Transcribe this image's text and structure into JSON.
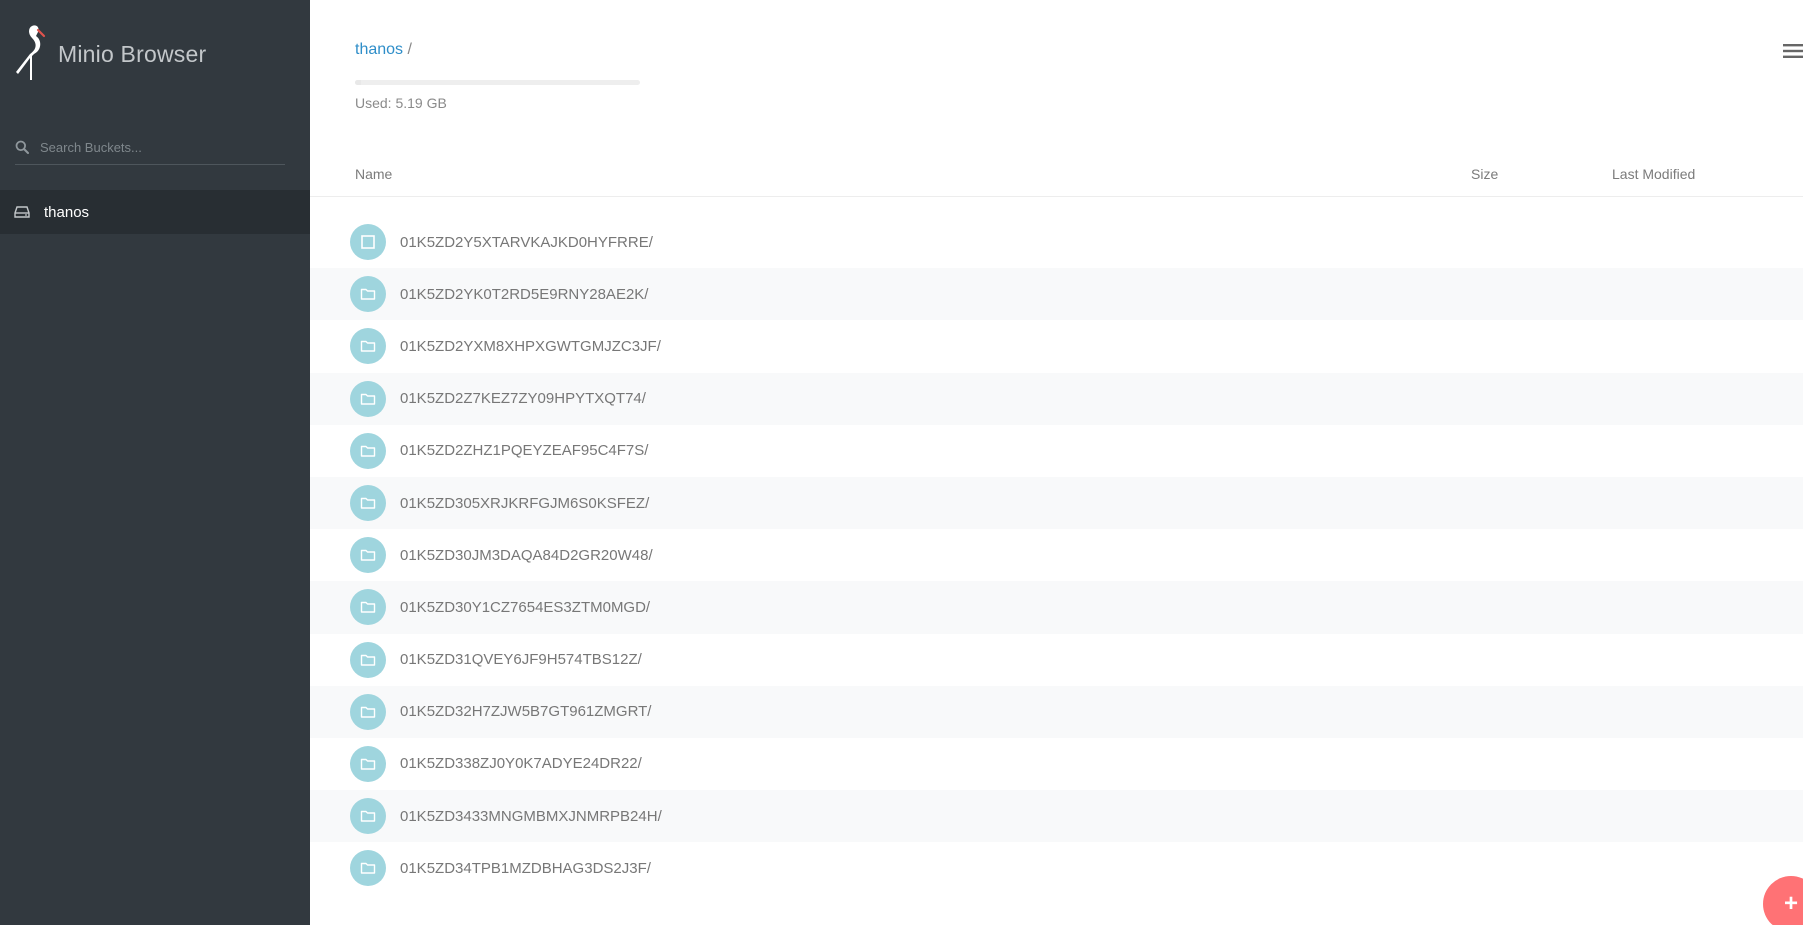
{
  "app": {
    "title": "Minio Browser"
  },
  "search": {
    "placeholder": "Search Buckets..."
  },
  "sidebar": {
    "buckets": [
      {
        "label": "thanos",
        "icon": "drive-icon"
      }
    ]
  },
  "header": {
    "breadcrumb_bucket": "thanos",
    "breadcrumb_sep": "/",
    "usage_label": "Used: 5.19 GB",
    "menu_icon": "hamburger-icon"
  },
  "table": {
    "columns": {
      "name": "Name",
      "size": "Size",
      "modified": "Last Modified"
    },
    "rows": [
      {
        "name": "01K5ZD2Y5XTARVKAJKD0HYFRRE/",
        "icon": "checkbox-icon"
      },
      {
        "name": "01K5ZD2YK0T2RD5E9RNY28AE2K/",
        "icon": "folder-icon"
      },
      {
        "name": "01K5ZD2YXM8XHPXGWTGMJZC3JF/",
        "icon": "folder-icon"
      },
      {
        "name": "01K5ZD2Z7KEZ7ZY09HPYTXQT74/",
        "icon": "folder-icon"
      },
      {
        "name": "01K5ZD2ZHZ1PQEYZEAF95C4F7S/",
        "icon": "folder-icon"
      },
      {
        "name": "01K5ZD305XRJKRFGJM6S0KSFEZ/",
        "icon": "folder-icon"
      },
      {
        "name": "01K5ZD30JM3DAQA84D2GR20W48/",
        "icon": "folder-icon"
      },
      {
        "name": "01K5ZD30Y1CZ7654ES3ZTM0MGD/",
        "icon": "folder-icon"
      },
      {
        "name": "01K5ZD31QVEY6JF9H574TBS12Z/",
        "icon": "folder-icon"
      },
      {
        "name": "01K5ZD32H7ZJW5B7GT961ZMGRT/",
        "icon": "folder-icon"
      },
      {
        "name": "01K5ZD338ZJ0Y0K7ADYE24DR22/",
        "icon": "folder-icon"
      },
      {
        "name": "01K5ZD3433MNGMBMXJNMRPB24H/",
        "icon": "folder-icon"
      },
      {
        "name": "01K5ZD34TPB1MZDBHAG3DS2J3F/",
        "icon": "folder-icon"
      }
    ]
  },
  "fab": {
    "label": "+",
    "icon": "plus-icon"
  },
  "colors": {
    "sidebar_bg": "#32393f",
    "active_bucket_bg": "#282e33",
    "link": "#2f8ec9",
    "icon_circle": "#9fd5de",
    "fab": "#ff7275"
  }
}
